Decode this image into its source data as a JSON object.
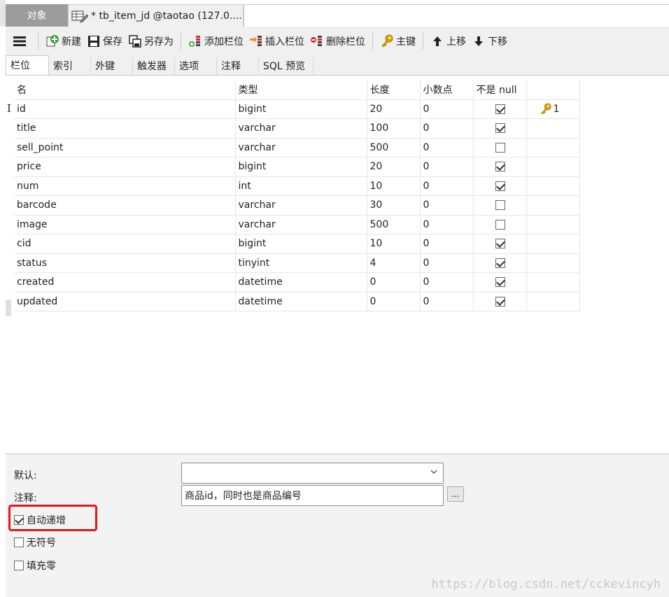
{
  "tabs": {
    "objects": "对象",
    "document": "* tb_item_jd @taotao (127.0...."
  },
  "toolbar": {
    "new": "新建",
    "save": "保存",
    "save_as": "另存为",
    "add_column": "添加栏位",
    "insert_column": "插入栏位",
    "delete_column": "删除栏位",
    "primary_key": "主键",
    "move_up": "上移",
    "move_down": "下移"
  },
  "subtabs": [
    "栏位",
    "索引",
    "外键",
    "触发器",
    "选项",
    "注释",
    "SQL 预览"
  ],
  "grid": {
    "headers": [
      "名",
      "类型",
      "长度",
      "小数点",
      "不是 null",
      ""
    ],
    "rows": [
      {
        "name": "id",
        "type": "bigint",
        "length": "20",
        "decimals": "0",
        "not_null": true,
        "key": "1"
      },
      {
        "name": "title",
        "type": "varchar",
        "length": "100",
        "decimals": "0",
        "not_null": true,
        "key": ""
      },
      {
        "name": "sell_point",
        "type": "varchar",
        "length": "500",
        "decimals": "0",
        "not_null": false,
        "key": ""
      },
      {
        "name": "price",
        "type": "bigint",
        "length": "20",
        "decimals": "0",
        "not_null": true,
        "key": ""
      },
      {
        "name": "num",
        "type": "int",
        "length": "10",
        "decimals": "0",
        "not_null": true,
        "key": ""
      },
      {
        "name": "barcode",
        "type": "varchar",
        "length": "30",
        "decimals": "0",
        "not_null": false,
        "key": ""
      },
      {
        "name": "image",
        "type": "varchar",
        "length": "500",
        "decimals": "0",
        "not_null": false,
        "key": ""
      },
      {
        "name": "cid",
        "type": "bigint",
        "length": "10",
        "decimals": "0",
        "not_null": true,
        "key": ""
      },
      {
        "name": "status",
        "type": "tinyint",
        "length": "4",
        "decimals": "0",
        "not_null": true,
        "key": ""
      },
      {
        "name": "created",
        "type": "datetime",
        "length": "0",
        "decimals": "0",
        "not_null": true,
        "key": ""
      },
      {
        "name": "updated",
        "type": "datetime",
        "length": "0",
        "decimals": "0",
        "not_null": true,
        "key": ""
      }
    ]
  },
  "props": {
    "default_label": "默认:",
    "default_value": "",
    "comment_label": "注释:",
    "comment_value": "商品id，同时也是商品编号",
    "ellipsis": "...",
    "auto_increment": {
      "label": "自动递增",
      "checked": true
    },
    "unsigned": {
      "label": "无符号",
      "checked": false
    },
    "zerofill": {
      "label": "填充零",
      "checked": false
    }
  },
  "watermark": "https://blog.csdn.net/cckevincyh",
  "colors": {
    "highlight": "#e8151b",
    "key_icon": "#e0a800",
    "add_icon": "#3aa435",
    "delete_icon": "#d9262b"
  }
}
